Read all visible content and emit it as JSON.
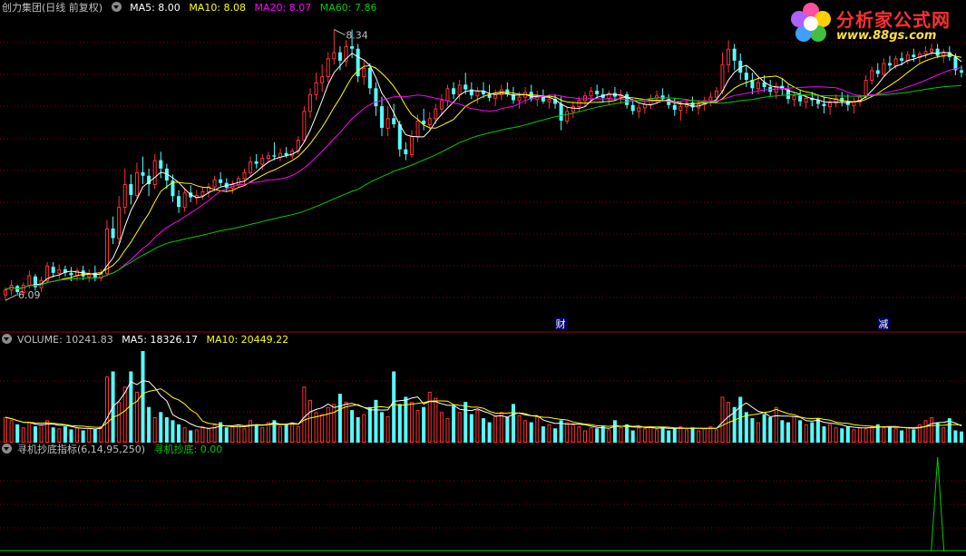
{
  "main_legend": {
    "title": "创力集团(日线 前复权)",
    "ma5": "MA5: 8.00",
    "ma10": "MA10: 8.08",
    "ma20": "MA20: 8.07",
    "ma60": "MA60: 7.86"
  },
  "volume_legend": {
    "volume": "VOLUME: 10241.83",
    "ma5": "MA5: 18326.17",
    "ma10": "MA10: 20449.22"
  },
  "indicator_legend": {
    "title": "寻机抄底指标(6,14,95,250)",
    "value": "寻机抄底: 0.00"
  },
  "logo": {
    "text": "分析家公式网",
    "url": "www.88gs.com"
  },
  "colors": {
    "up": "#ff3232",
    "down": "#54ffff",
    "ma5": "#ffffff",
    "ma10": "#ffff00",
    "ma20": "#ff00ff",
    "ma60": "#00cc00",
    "grid": "#8b0000",
    "divider": "#a00000",
    "signal": "#00cc00"
  },
  "chart_data": {
    "type": "candlestick",
    "price_range": [
      5.9,
      8.45
    ],
    "high_label": "8.34",
    "low_label": "6.09",
    "event_markers": [
      {
        "bar": 93,
        "label": "财"
      },
      {
        "bar": 147,
        "label": "减"
      }
    ],
    "candles": [
      [
        6.13,
        6.19,
        6.08,
        6.17
      ],
      [
        6.17,
        6.25,
        6.12,
        6.21
      ],
      [
        6.2,
        6.21,
        6.12,
        6.15
      ],
      [
        6.15,
        6.23,
        6.12,
        6.21
      ],
      [
        6.21,
        6.33,
        6.18,
        6.29
      ],
      [
        6.28,
        6.3,
        6.16,
        6.19
      ],
      [
        6.19,
        6.28,
        6.15,
        6.25
      ],
      [
        6.25,
        6.4,
        6.22,
        6.37
      ],
      [
        6.36,
        6.4,
        6.27,
        6.31
      ],
      [
        6.31,
        6.38,
        6.26,
        6.34
      ],
      [
        6.34,
        6.37,
        6.28,
        6.31
      ],
      [
        6.31,
        6.36,
        6.24,
        6.29
      ],
      [
        6.29,
        6.35,
        6.24,
        6.33
      ],
      [
        6.33,
        6.37,
        6.25,
        6.28
      ],
      [
        6.28,
        6.34,
        6.23,
        6.31
      ],
      [
        6.31,
        6.37,
        6.24,
        6.27
      ],
      [
        6.27,
        6.34,
        6.24,
        6.31
      ],
      [
        6.31,
        6.75,
        6.28,
        6.68
      ],
      [
        6.68,
        6.78,
        6.55,
        6.6
      ],
      [
        6.6,
        6.95,
        6.55,
        6.86
      ],
      [
        6.86,
        7.18,
        6.8,
        7.05
      ],
      [
        7.05,
        7.13,
        6.88,
        6.96
      ],
      [
        6.96,
        7.23,
        6.93,
        7.15
      ],
      [
        7.15,
        7.28,
        7.05,
        7.12
      ],
      [
        7.12,
        7.18,
        6.95,
        7.05
      ],
      [
        7.05,
        7.3,
        7.01,
        7.25
      ],
      [
        7.25,
        7.32,
        7.1,
        7.18
      ],
      [
        7.18,
        7.22,
        7.01,
        7.08
      ],
      [
        7.08,
        7.13,
        6.9,
        6.95
      ],
      [
        6.95,
        7.0,
        6.81,
        6.86
      ],
      [
        6.86,
        7.02,
        6.82,
        6.98
      ],
      [
        6.98,
        7.04,
        6.9,
        6.94
      ],
      [
        6.94,
        7.0,
        6.88,
        6.96
      ],
      [
        6.96,
        7.02,
        6.92,
        6.99
      ],
      [
        6.99,
        7.06,
        6.94,
        7.03
      ],
      [
        7.03,
        7.12,
        6.99,
        7.09
      ],
      [
        7.09,
        7.15,
        7.03,
        7.06
      ],
      [
        7.06,
        7.1,
        6.99,
        7.02
      ],
      [
        7.02,
        7.08,
        6.97,
        7.05
      ],
      [
        7.05,
        7.12,
        7.02,
        7.1
      ],
      [
        7.1,
        7.18,
        7.05,
        7.15
      ],
      [
        7.15,
        7.28,
        7.11,
        7.24
      ],
      [
        7.24,
        7.3,
        7.18,
        7.22
      ],
      [
        7.22,
        7.3,
        7.17,
        7.27
      ],
      [
        7.27,
        7.32,
        7.23,
        7.29
      ],
      [
        7.29,
        7.4,
        7.25,
        7.28
      ],
      [
        7.28,
        7.35,
        7.24,
        7.31
      ],
      [
        7.31,
        7.36,
        7.27,
        7.29
      ],
      [
        7.29,
        7.35,
        7.26,
        7.33
      ],
      [
        7.33,
        7.45,
        7.3,
        7.42
      ],
      [
        7.42,
        7.7,
        7.4,
        7.66
      ],
      [
        7.66,
        7.85,
        7.6,
        7.8
      ],
      [
        7.8,
        7.98,
        7.75,
        7.9
      ],
      [
        7.9,
        8.05,
        7.82,
        7.95
      ],
      [
        7.95,
        8.15,
        7.9,
        8.1
      ],
      [
        8.1,
        8.34,
        8.05,
        8.15
      ],
      [
        8.15,
        8.2,
        8.0,
        8.08
      ],
      [
        8.08,
        8.25,
        8.03,
        8.2
      ],
      [
        8.2,
        8.34,
        8.1,
        8.18
      ],
      [
        8.18,
        8.22,
        7.9,
        7.95
      ],
      [
        7.95,
        8.08,
        7.88,
        8.02
      ],
      [
        8.02,
        8.06,
        7.8,
        7.85
      ],
      [
        7.85,
        7.9,
        7.62,
        7.7
      ],
      [
        7.7,
        7.78,
        7.45,
        7.52
      ],
      [
        7.52,
        7.7,
        7.45,
        7.6
      ],
      [
        7.6,
        7.72,
        7.52,
        7.55
      ],
      [
        7.55,
        7.58,
        7.28,
        7.34
      ],
      [
        7.34,
        7.4,
        7.25,
        7.3
      ],
      [
        7.3,
        7.5,
        7.27,
        7.45
      ],
      [
        7.45,
        7.63,
        7.4,
        7.58
      ],
      [
        7.58,
        7.68,
        7.5,
        7.55
      ],
      [
        7.55,
        7.65,
        7.5,
        7.6
      ],
      [
        7.6,
        7.72,
        7.55,
        7.68
      ],
      [
        7.68,
        7.8,
        7.62,
        7.75
      ],
      [
        7.75,
        7.88,
        7.7,
        7.85
      ],
      [
        7.85,
        7.9,
        7.76,
        7.8
      ],
      [
        7.8,
        7.92,
        7.75,
        7.88
      ],
      [
        7.88,
        7.98,
        7.8,
        7.84
      ],
      [
        7.84,
        7.9,
        7.76,
        7.79
      ],
      [
        7.79,
        7.86,
        7.72,
        7.83
      ],
      [
        7.83,
        7.9,
        7.77,
        7.8
      ],
      [
        7.8,
        7.88,
        7.74,
        7.77
      ],
      [
        7.77,
        7.84,
        7.7,
        7.8
      ],
      [
        7.8,
        7.88,
        7.75,
        7.84
      ],
      [
        7.84,
        7.9,
        7.78,
        7.8
      ],
      [
        7.8,
        7.86,
        7.72,
        7.75
      ],
      [
        7.75,
        7.82,
        7.68,
        7.78
      ],
      [
        7.78,
        7.86,
        7.72,
        7.82
      ],
      [
        7.82,
        7.88,
        7.74,
        7.76
      ],
      [
        7.76,
        7.83,
        7.7,
        7.79
      ],
      [
        7.79,
        7.84,
        7.72,
        7.74
      ],
      [
        7.74,
        7.8,
        7.68,
        7.76
      ],
      [
        7.76,
        7.8,
        7.68,
        7.72
      ],
      [
        7.72,
        7.78,
        7.5,
        7.58
      ],
      [
        7.58,
        7.7,
        7.55,
        7.66
      ],
      [
        7.66,
        7.74,
        7.6,
        7.7
      ],
      [
        7.7,
        7.78,
        7.65,
        7.75
      ],
      [
        7.75,
        7.82,
        7.7,
        7.79
      ],
      [
        7.79,
        7.86,
        7.74,
        7.83
      ],
      [
        7.83,
        7.88,
        7.76,
        7.8
      ],
      [
        7.8,
        7.85,
        7.73,
        7.77
      ],
      [
        7.77,
        7.83,
        7.71,
        7.81
      ],
      [
        7.81,
        7.86,
        7.75,
        7.78
      ],
      [
        7.78,
        7.84,
        7.72,
        7.8
      ],
      [
        7.8,
        7.82,
        7.68,
        7.71
      ],
      [
        7.71,
        7.76,
        7.63,
        7.66
      ],
      [
        7.66,
        7.72,
        7.6,
        7.69
      ],
      [
        7.69,
        7.75,
        7.64,
        7.72
      ],
      [
        7.72,
        7.8,
        7.68,
        7.77
      ],
      [
        7.77,
        7.83,
        7.72,
        7.79
      ],
      [
        7.79,
        7.85,
        7.74,
        7.76
      ],
      [
        7.76,
        7.8,
        7.68,
        7.71
      ],
      [
        7.71,
        7.77,
        7.62,
        7.67
      ],
      [
        7.67,
        7.74,
        7.58,
        7.7
      ],
      [
        7.7,
        7.76,
        7.64,
        7.73
      ],
      [
        7.73,
        7.78,
        7.66,
        7.69
      ],
      [
        7.69,
        7.75,
        7.63,
        7.72
      ],
      [
        7.72,
        7.78,
        7.66,
        7.75
      ],
      [
        7.75,
        7.82,
        7.7,
        7.78
      ],
      [
        7.78,
        7.86,
        7.74,
        7.83
      ],
      [
        7.83,
        8.15,
        7.8,
        8.05
      ],
      [
        8.05,
        8.25,
        7.98,
        8.18
      ],
      [
        8.18,
        8.22,
        8.0,
        8.08
      ],
      [
        8.08,
        8.14,
        7.92,
        7.98
      ],
      [
        7.98,
        8.04,
        7.86,
        7.92
      ],
      [
        7.92,
        7.98,
        7.8,
        7.85
      ],
      [
        7.85,
        7.94,
        7.8,
        7.9
      ],
      [
        7.9,
        7.96,
        7.82,
        7.86
      ],
      [
        7.86,
        7.92,
        7.78,
        7.82
      ],
      [
        7.82,
        7.9,
        7.76,
        7.87
      ],
      [
        7.87,
        7.93,
        7.79,
        7.84
      ],
      [
        7.84,
        7.88,
        7.72,
        7.76
      ],
      [
        7.76,
        7.82,
        7.7,
        7.79
      ],
      [
        7.79,
        7.84,
        7.7,
        7.74
      ],
      [
        7.74,
        7.8,
        7.68,
        7.77
      ],
      [
        7.77,
        7.82,
        7.7,
        7.75
      ],
      [
        7.75,
        7.8,
        7.68,
        7.72
      ],
      [
        7.72,
        7.78,
        7.64,
        7.7
      ],
      [
        7.7,
        7.76,
        7.63,
        7.73
      ],
      [
        7.73,
        7.8,
        7.69,
        7.77
      ],
      [
        7.77,
        7.82,
        7.7,
        7.74
      ],
      [
        7.74,
        7.8,
        7.66,
        7.71
      ],
      [
        7.71,
        7.77,
        7.64,
        7.74
      ],
      [
        7.74,
        7.8,
        7.7,
        7.78
      ],
      [
        7.78,
        7.96,
        7.76,
        7.92
      ],
      [
        7.92,
        8.03,
        7.88,
        8.0
      ],
      [
        8.0,
        8.06,
        7.94,
        7.97
      ],
      [
        7.97,
        8.1,
        7.95,
        8.06
      ],
      [
        8.06,
        8.12,
        8.0,
        8.04
      ],
      [
        8.04,
        8.12,
        8.01,
        8.1
      ],
      [
        8.1,
        8.15,
        8.04,
        8.08
      ],
      [
        8.08,
        8.16,
        8.05,
        8.13
      ],
      [
        8.13,
        8.18,
        8.07,
        8.11
      ],
      [
        8.11,
        8.16,
        8.06,
        8.14
      ],
      [
        8.14,
        8.2,
        8.1,
        8.16
      ],
      [
        8.16,
        8.22,
        8.12,
        8.18
      ],
      [
        8.18,
        8.22,
        8.1,
        8.12
      ],
      [
        8.12,
        8.18,
        8.06,
        8.15
      ],
      [
        8.15,
        8.2,
        8.08,
        8.11
      ],
      [
        8.11,
        8.14,
        7.96,
        8.0
      ],
      [
        8.0,
        8.04,
        7.94,
        7.98
      ]
    ],
    "volumes": [
      2.5,
      2.2,
      1.8,
      1.5,
      2.0,
      1.6,
      1.8,
      2.2,
      1.5,
      1.4,
      1.6,
      1.3,
      1.5,
      1.2,
      1.4,
      1.3,
      1.6,
      6.5,
      7.0,
      4.0,
      5.5,
      7.0,
      5.0,
      9.0,
      3.5,
      2.5,
      3.0,
      2.5,
      2.2,
      1.8,
      1.5,
      1.2,
      1.3,
      1.6,
      1.4,
      1.8,
      2.0,
      1.5,
      1.6,
      1.8,
      1.4,
      2.2,
      1.8,
      1.5,
      2.0,
      2.2,
      1.6,
      1.8,
      2.0,
      1.6,
      5.5,
      4.2,
      3.0,
      2.8,
      3.5,
      3.8,
      4.8,
      4.0,
      3.2,
      2.5,
      2.8,
      3.5,
      4.2,
      3.0,
      2.6,
      7.0,
      3.8,
      4.5,
      4.0,
      3.2,
      3.5,
      5.0,
      4.4,
      3.0,
      2.4,
      3.6,
      3.0,
      4.0,
      2.8,
      3.2,
      2.4,
      2.0,
      2.6,
      3.0,
      2.5,
      3.8,
      2.7,
      2.2,
      2.0,
      2.6,
      1.6,
      1.8,
      1.4,
      2.2,
      2.0,
      1.8,
      1.6,
      1.2,
      1.5,
      1.4,
      1.6,
      1.3,
      2.2,
      1.5,
      1.8,
      1.2,
      1.5,
      1.4,
      1.6,
      1.3,
      1.5,
      1.2,
      1.4,
      1.6,
      1.3,
      1.5,
      1.2,
      1.4,
      1.6,
      1.3,
      4.5,
      4.0,
      3.5,
      4.5,
      3.0,
      2.4,
      2.0,
      2.8,
      2.5,
      3.5,
      2.2,
      2.0,
      2.6,
      2.2,
      1.8,
      2.0,
      2.4,
      1.6,
      1.8,
      1.5,
      1.4,
      1.6,
      1.3,
      1.5,
      1.4,
      1.6,
      1.8,
      1.5,
      1.6,
      1.4,
      1.2,
      1.5,
      1.3,
      1.8,
      2.2,
      2.5,
      2.0,
      1.5,
      2.4,
      1.2,
      1.1
    ],
    "signal": {
      "bar": 156,
      "value": 1.0
    }
  }
}
